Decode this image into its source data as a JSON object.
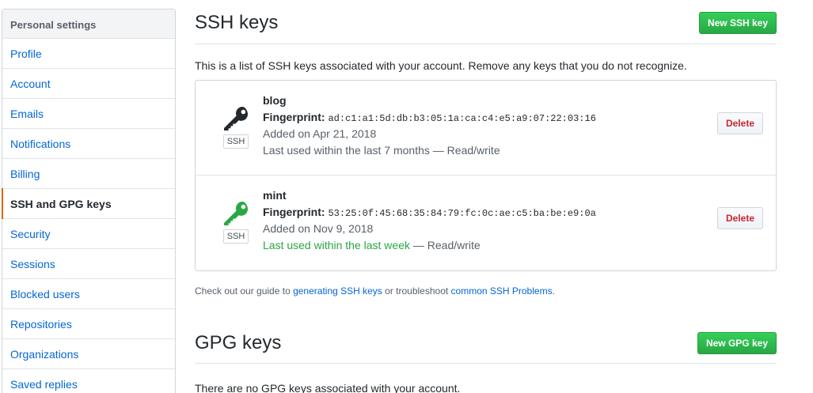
{
  "sidebar": {
    "header": "Personal settings",
    "items": [
      {
        "label": "Profile"
      },
      {
        "label": "Account"
      },
      {
        "label": "Emails"
      },
      {
        "label": "Notifications"
      },
      {
        "label": "Billing"
      },
      {
        "label": "SSH and GPG keys",
        "selected": true
      },
      {
        "label": "Security"
      },
      {
        "label": "Sessions"
      },
      {
        "label": "Blocked users"
      },
      {
        "label": "Repositories"
      },
      {
        "label": "Organizations"
      },
      {
        "label": "Saved replies"
      }
    ]
  },
  "ssh": {
    "title": "SSH keys",
    "new_button": "New SSH key",
    "intro": "This is a list of SSH keys associated with your account. Remove any keys that you do not recognize.",
    "keys": [
      {
        "name": "blog",
        "fingerprint_label": "Fingerprint:",
        "fingerprint": "ad:c1:a1:5d:db:b3:05:1a:ca:c4:e5:a9:07:22:03:16",
        "added": "Added on Apr 21, 2018",
        "last_used": "Last used within the last 7 months",
        "access": " — Read/write",
        "badge": "SSH",
        "delete_label": "Delete",
        "icon": "key-icon",
        "icon_color": "#24292e"
      },
      {
        "name": "mint",
        "fingerprint_label": "Fingerprint:",
        "fingerprint": "53:25:0f:45:68:35:84:79:fc:0c:ae:c5:ba:be:e9:0a",
        "added": "Added on Nov 9, 2018",
        "last_used": "Last used within the last week",
        "access": " — Read/write",
        "badge": "SSH",
        "delete_label": "Delete",
        "icon": "key-icon",
        "icon_color": "#28a745"
      }
    ],
    "guide": {
      "prefix": "Check out our guide to ",
      "link1": "generating SSH keys",
      "middle": " or troubleshoot ",
      "link2": "common SSH Problems",
      "suffix": "."
    }
  },
  "gpg": {
    "title": "GPG keys",
    "new_button": "New GPG key",
    "empty": "There are no GPG keys associated with your account."
  },
  "colors": {
    "link": "#0366d6",
    "success": "#28a745",
    "danger": "#cb2431",
    "accent": "#e36209"
  }
}
